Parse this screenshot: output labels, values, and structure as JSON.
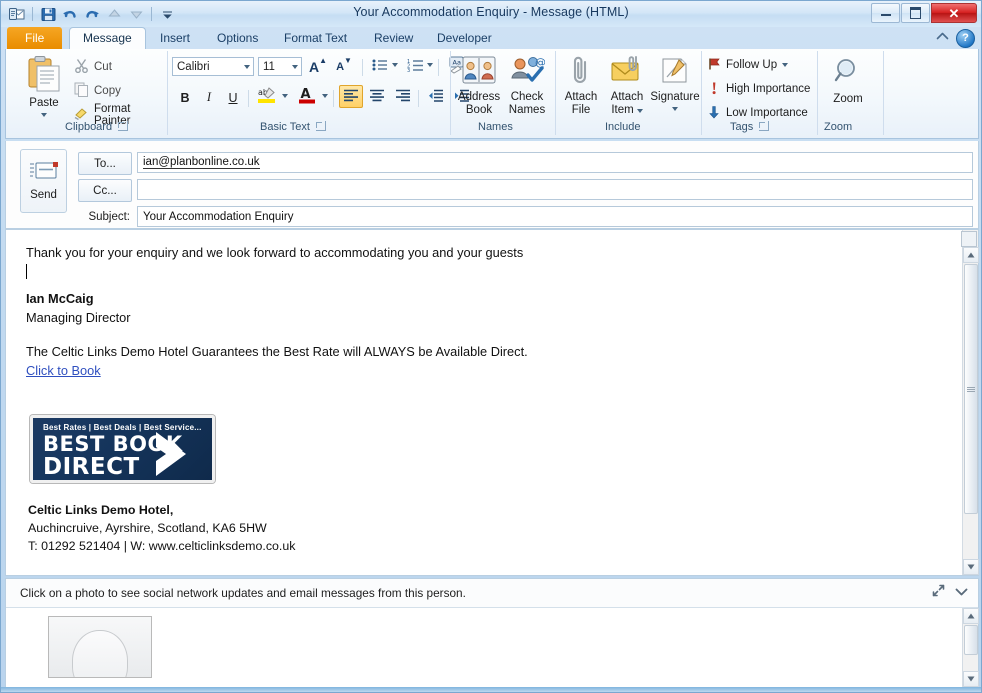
{
  "window": {
    "title": "Your Accommodation Enquiry  -  Message (HTML)",
    "minimize_label": "Minimize",
    "maximize_label": "Maximize",
    "close_label": "✕"
  },
  "quick_access": [
    {
      "name": "outlook-logo-icon",
      "label": "Outlook"
    },
    {
      "name": "save-icon",
      "label": "Save"
    },
    {
      "name": "undo-icon",
      "label": "Undo"
    },
    {
      "name": "redo-icon",
      "label": "Redo"
    },
    {
      "name": "previous-item-icon",
      "label": "Previous Item"
    },
    {
      "name": "next-item-icon",
      "label": "Next Item"
    },
    {
      "name": "customize-qat-icon",
      "label": "Customize Quick Access Toolbar"
    }
  ],
  "tabs": [
    {
      "label": "File",
      "active": false,
      "kind": "file"
    },
    {
      "label": "Message",
      "active": true,
      "kind": "normal"
    },
    {
      "label": "Insert",
      "active": false,
      "kind": "normal"
    },
    {
      "label": "Options",
      "active": false,
      "kind": "normal"
    },
    {
      "label": "Format Text",
      "active": false,
      "kind": "normal"
    },
    {
      "label": "Review",
      "active": false,
      "kind": "normal"
    },
    {
      "label": "Developer",
      "active": false,
      "kind": "normal"
    }
  ],
  "ribbon_controls": {
    "collapse_label": "Minimize the Ribbon",
    "help_label": "?"
  },
  "ribbon": {
    "groups": [
      {
        "name": "clipboard",
        "label": "Clipboard",
        "has_dialog_launcher": true
      },
      {
        "name": "basic-text",
        "label": "Basic Text",
        "has_dialog_launcher": true
      },
      {
        "name": "names",
        "label": "Names",
        "has_dialog_launcher": false
      },
      {
        "name": "include",
        "label": "Include",
        "has_dialog_launcher": false
      },
      {
        "name": "tags",
        "label": "Tags",
        "has_dialog_launcher": true
      },
      {
        "name": "zoom",
        "label": "Zoom",
        "has_dialog_launcher": false
      }
    ],
    "clipboard": {
      "paste_label": "Paste",
      "cut_label": "Cut",
      "copy_label": "Copy",
      "format_painter_label": "Format Painter"
    },
    "basic_text": {
      "font_name": "Calibri",
      "font_size": "11",
      "grow_font_label": "A",
      "shrink_font_label": "A",
      "bold_label": "B",
      "italic_label": "I",
      "underline_label": "U",
      "highlight_color": "#ffe400",
      "font_color": "#cc0000",
      "bullets_label": "Bullets",
      "numbering_label": "Numbering",
      "clear_formatting_label": "Clear Formatting",
      "align_left_label": "Align Text Left",
      "align_center_label": "Center",
      "align_right_label": "Align Text Right",
      "decrease_indent_label": "Decrease Indent",
      "increase_indent_label": "Increase Indent"
    },
    "names": {
      "address_book_line1": "Address",
      "address_book_line2": "Book",
      "check_names_line1": "Check",
      "check_names_line2": "Names"
    },
    "include": {
      "attach_file_line1": "Attach",
      "attach_file_line2": "File",
      "attach_item_line1": "Attach",
      "attach_item_line2": "Item",
      "signature_label": "Signature"
    },
    "tags": {
      "follow_up_label": "Follow Up",
      "high_importance_label": "High Importance",
      "low_importance_label": "Low Importance"
    },
    "zoom_group": {
      "zoom_label": "Zoom"
    }
  },
  "header": {
    "send_label": "Send",
    "to_label": "To...",
    "cc_label": "Cc...",
    "subject_label": "Subject:",
    "to_value": "ian@planbonline.co.uk",
    "cc_value": "",
    "subject_value": "Your Accommodation Enquiry"
  },
  "body": {
    "paragraph1": "Thank you for your enquiry and we look forward to accommodating you and your guests",
    "sender_name": "Ian McCaig",
    "sender_title": "Managing Director",
    "guarantee_line": "The Celtic Links Demo Hotel Guarantees the Best Rate will ALWAYS be Available Direct.",
    "book_link": "Click to Book",
    "logo": {
      "tagline": "Best Rates | Best Deals | Best Service...",
      "line1": "BEST BOOK",
      "line2": "DIRECT"
    },
    "signature": {
      "company": "Celtic Links Demo Hotel,",
      "address": "Auchincruive, Ayrshire, Scotland, KA6 5HW",
      "contact": "T: 01292 521404  |  W: www.celticlinksdemo.co.uk"
    }
  },
  "people_pane": {
    "message": "Click on a photo to see social network updates and email messages from this person.",
    "expand_label": "Expand",
    "collapse_label": "Collapse"
  }
}
